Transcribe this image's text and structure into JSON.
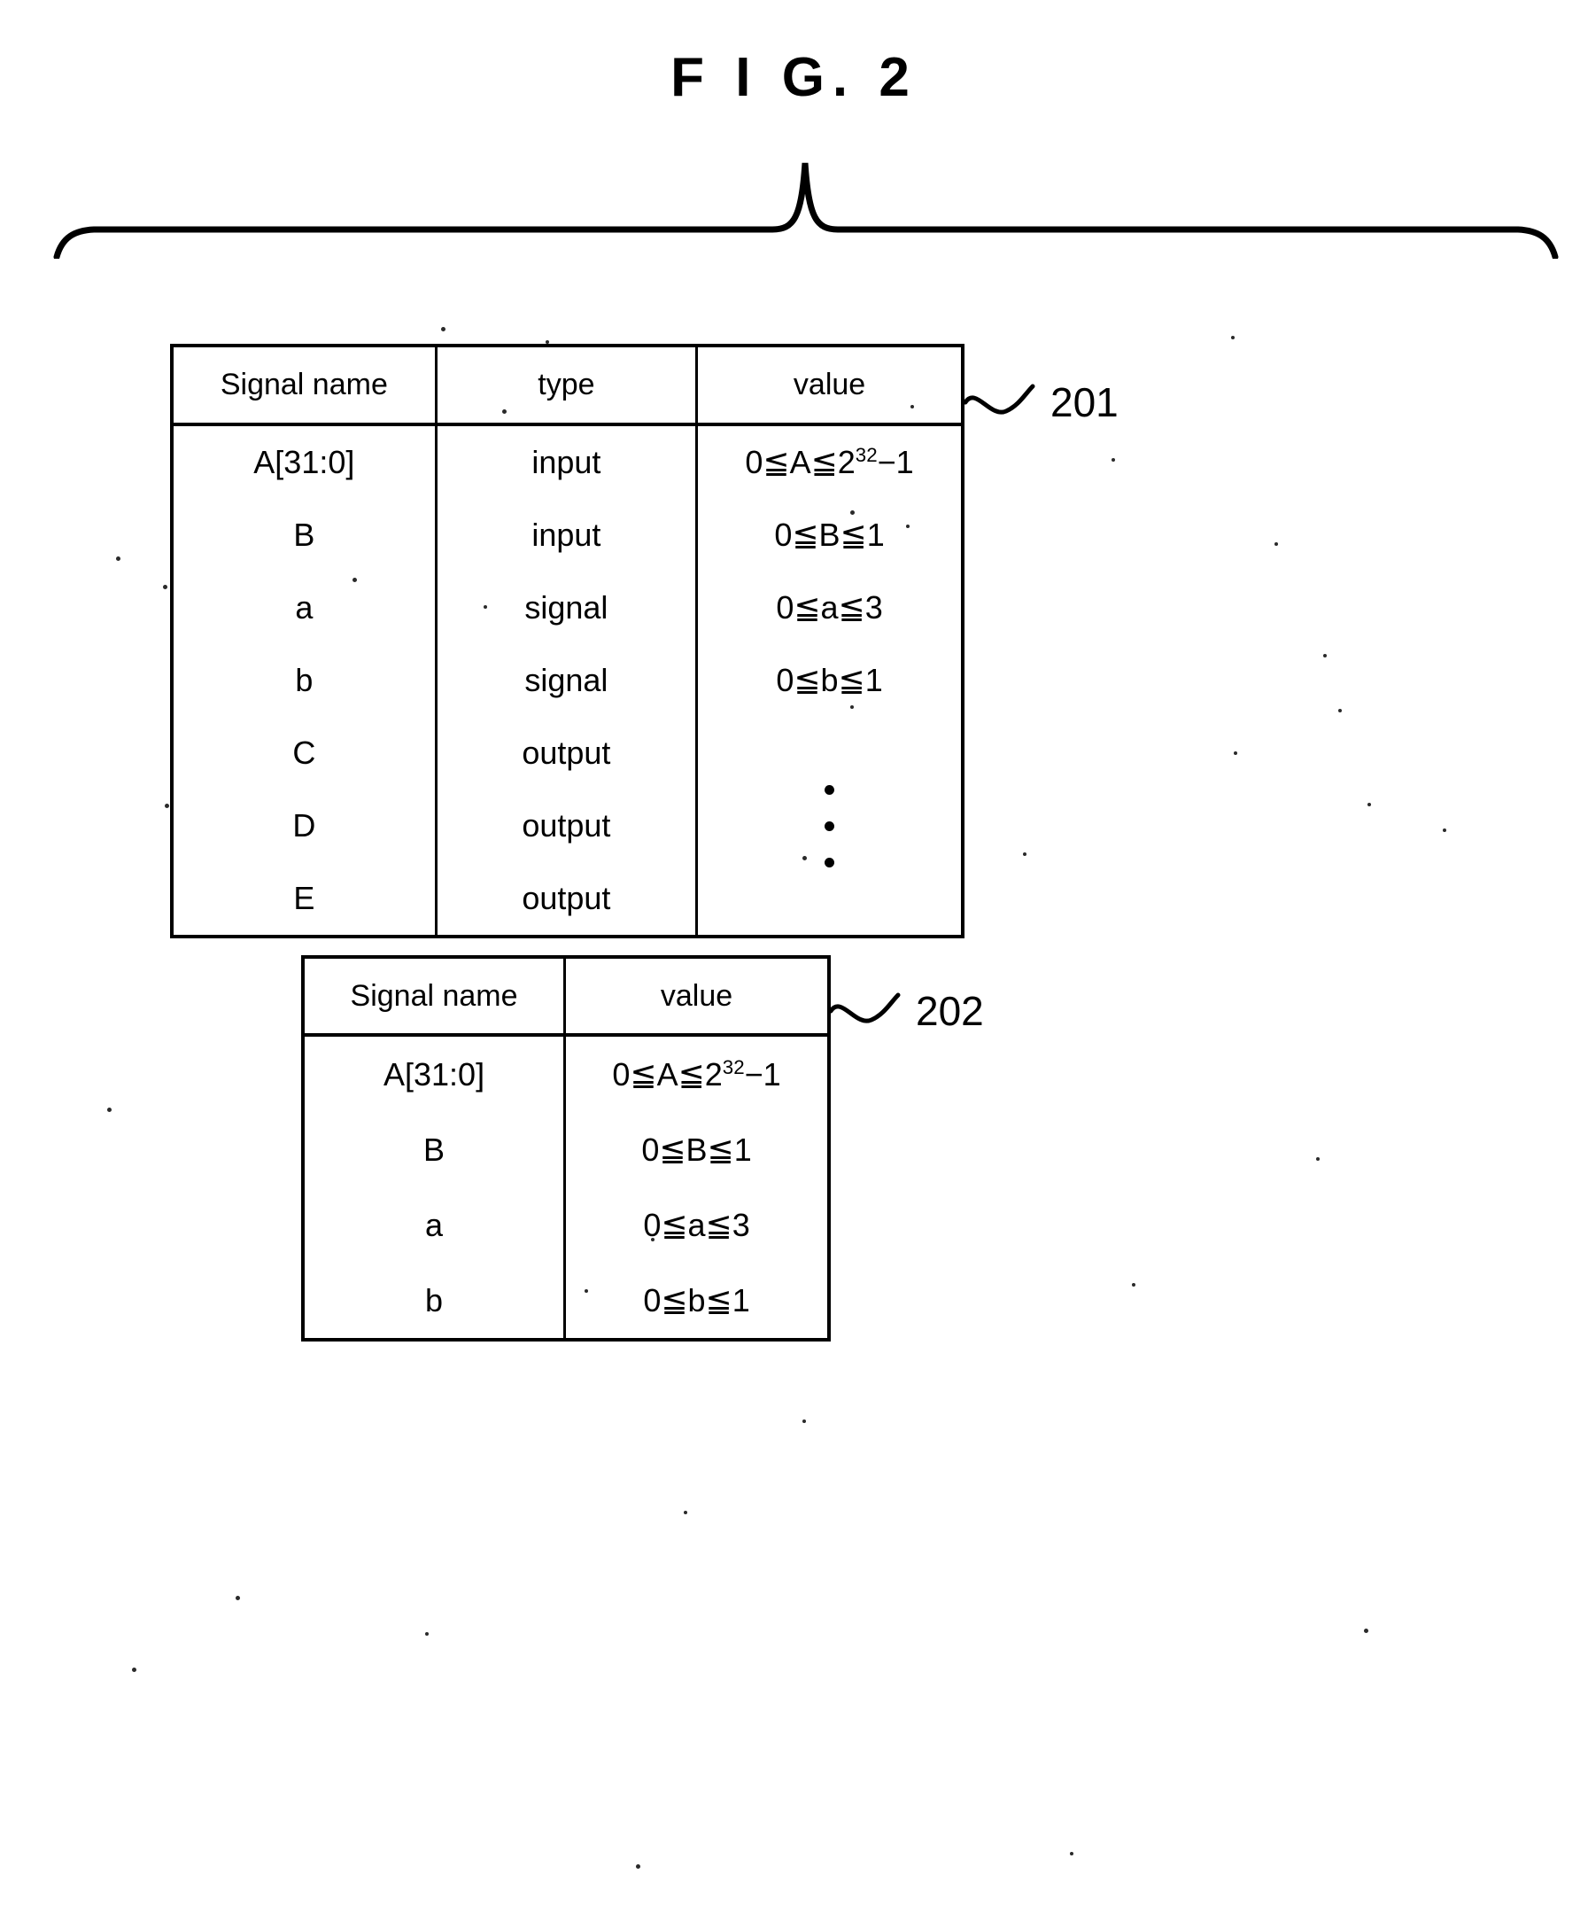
{
  "figure": {
    "title": "F I G.  2"
  },
  "brace": {
    "name": "top-grouping-brace"
  },
  "table_201": {
    "ref_label": "201",
    "headers": [
      "Signal name",
      "type",
      "value"
    ],
    "rows": [
      {
        "signal": "A[31:0]",
        "type": "input",
        "value_base": "0≦A≦2",
        "value_sup": "32",
        "value_tail": "−1"
      },
      {
        "signal": "B",
        "type": "input",
        "value_base": "0≦B≦1",
        "value_sup": "",
        "value_tail": ""
      },
      {
        "signal": "a",
        "type": "signal",
        "value_base": "0≦a≦3",
        "value_sup": "",
        "value_tail": ""
      },
      {
        "signal": "b",
        "type": "signal",
        "value_base": "0≦b≦1",
        "value_sup": "",
        "value_tail": ""
      },
      {
        "signal": "C",
        "type": "output",
        "value_base": "",
        "value_sup": "",
        "value_tail": ""
      },
      {
        "signal": "D",
        "type": "output",
        "value_base": "",
        "value_sup": "",
        "value_tail": ""
      },
      {
        "signal": "E",
        "type": "output",
        "value_base": "",
        "value_sup": "",
        "value_tail": ""
      }
    ],
    "value_continuation": "vertical-ellipsis"
  },
  "table_202": {
    "ref_label": "202",
    "headers": [
      "Signal name",
      "value"
    ],
    "rows": [
      {
        "signal": "A[31:0]",
        "value_base": "0≦A≦2",
        "value_sup": "32",
        "value_tail": "−1"
      },
      {
        "signal": "B",
        "value_base": "0≦B≦1",
        "value_sup": "",
        "value_tail": ""
      },
      {
        "signal": "a",
        "value_base": "0≦a≦3",
        "value_sup": "",
        "value_tail": ""
      },
      {
        "signal": "b",
        "value_base": "0≦b≦1",
        "value_sup": "",
        "value_tail": ""
      }
    ]
  },
  "colors": {
    "ink": "#000000",
    "paper": "#ffffff"
  }
}
